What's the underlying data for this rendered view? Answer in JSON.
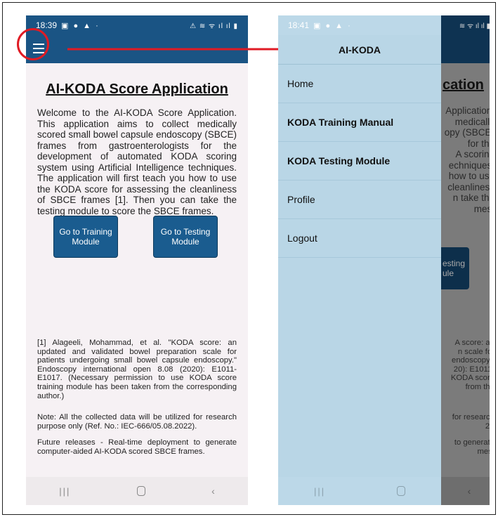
{
  "left": {
    "status_time": "18:39",
    "title": "AI-KODA Score Application",
    "welcome": "Welcome to the AI-KODA Score Application. This application aims to collect medically scored small bowel capsule endoscopy (SBCE) frames from gastroenterologists for the development of automated KODA scoring system using Artificial Intelligence techniques. The application will first teach you how to use the KODA score for assessing the cleanliness of SBCE frames [1]. Then you can take the testing module to score the SBCE frames.",
    "btn_training": "Go to Training Module",
    "btn_testing": "Go to Testing Module",
    "reference": "[1] Alageeli, Mohammad, et al. \"KODA score: an updated and validated bowel preparation scale for patients undergoing small bowel capsule endoscopy.\" Endoscopy international open 8.08 (2020): E1011-E1017. (Necessary permission to use KODA score training module has been taken from the corresponding author.)",
    "note": "Note: All the collected data will be utilized for research purpose only (Ref. No.: IEC-666/05.08.2022).",
    "future": "Future releases - Real-time deployment to generate computer-aided AI-KODA scored SBCE frames."
  },
  "right": {
    "status_time": "18:41",
    "drawer_title": "AI-KODA",
    "menu": [
      "Home",
      "KODA Training Manual",
      "KODA Testing Module",
      "Profile",
      "Logout"
    ],
    "dim_title": "cation",
    "dim_lines": [
      "Application.",
      "medically",
      "opy (SBCE)",
      "for the",
      "A scoring",
      "echniques.",
      "how to use",
      "cleanliness",
      "n take the",
      "mes."
    ],
    "dim_btn": [
      "esting",
      "ule"
    ],
    "dim_ref": [
      "A score: an",
      "n scale for",
      "endoscopy.\"",
      "20): E1011-",
      "KODA score",
      "from the"
    ],
    "dim_note": [
      "for research",
      "2)."
    ],
    "dim_future": [
      "to generate",
      "mes."
    ]
  },
  "icons": {
    "menu": "hamburger-icon",
    "recents": "recents-icon",
    "home": "home-icon",
    "back": "back-icon"
  },
  "colors": {
    "appbar": "#1a5484",
    "button": "#1a5c8f",
    "drawer": "#b9d6e6",
    "annotation": "#e01b24"
  }
}
